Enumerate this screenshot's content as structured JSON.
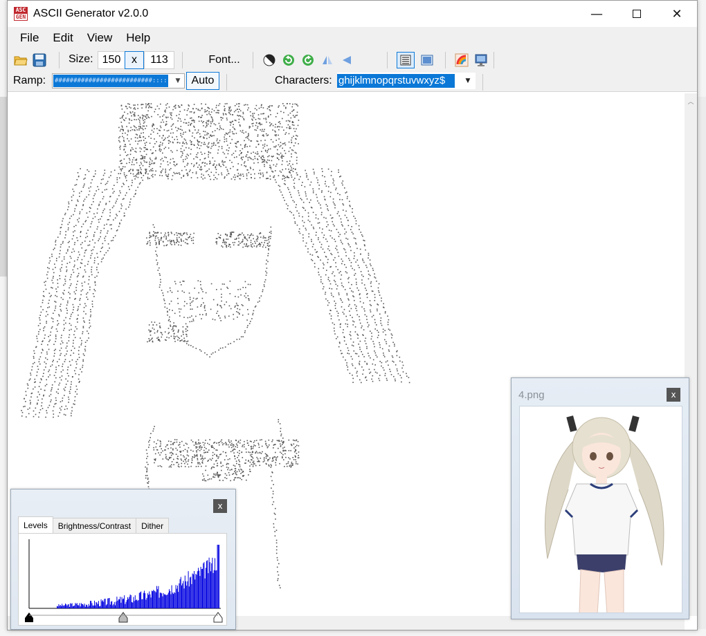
{
  "window": {
    "title": "ASCII Generator v2.0.0",
    "app_icon_top": "ASC",
    "app_icon_bottom": "GEN",
    "minimize_symbol": "—",
    "close_symbol": "✕"
  },
  "menu": {
    "items": [
      "File",
      "Edit",
      "View",
      "Help"
    ]
  },
  "toolbar": {
    "size_label": "Size:",
    "width_value": "150",
    "size_separator": "x",
    "height_value": "113",
    "font_button": "Font...",
    "ramp_label": "Ramp:",
    "ramp_value": "##########################::::::::::::,,,,,,,,,,,,,,,",
    "auto_button": "Auto",
    "characters_label": "Characters:",
    "characters_value": "ghijklmnopqrstuvwxyz$"
  },
  "preview_panel": {
    "title": "4.png",
    "close_symbol": "x"
  },
  "levels_panel": {
    "close_symbol": "x",
    "tabs": [
      "Levels",
      "Brightness/Contrast",
      "Dither"
    ],
    "active_tab": "Levels"
  },
  "colors": {
    "accent": "#0b78d7",
    "histogram": "#0000e0",
    "app_icon": "#c0272d"
  },
  "icons": [
    "folder-open-icon",
    "save-icon",
    "invert-icon",
    "rotate-left-icon",
    "rotate-right-icon",
    "flip-horizontal-icon",
    "flip-vertical-icon",
    "text-view-icon",
    "image-view-icon",
    "color-icon",
    "monitor-icon"
  ]
}
